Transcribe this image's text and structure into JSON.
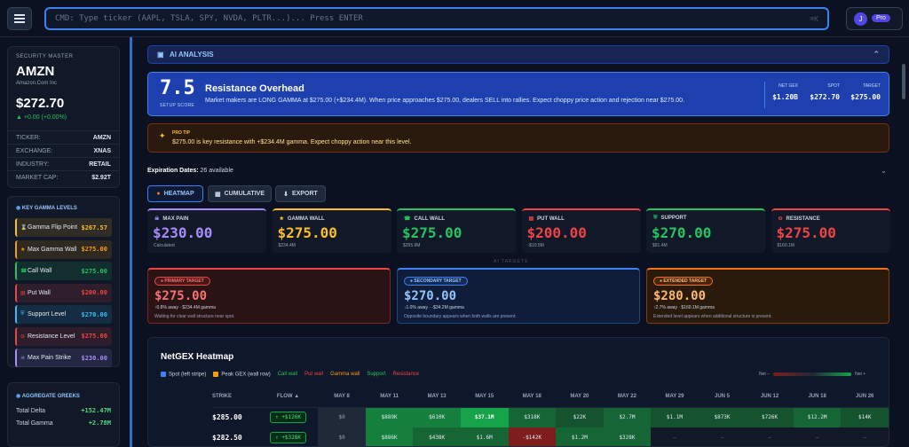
{
  "topbar": {
    "cmd_placeholder": "CMD: Type ticker (AAPL, TSLA, SPY, NVDA, PLTR...)... Press ENTER",
    "shortcut": "⌘K",
    "user_initial": "J",
    "plan_badge": "Pro"
  },
  "security": {
    "section_label": "SECURITY MASTER",
    "ticker": "AMZN",
    "name": "Amazon.Com Inc",
    "price": "$272.70",
    "change": "▲ +0.00 (+0.00%)",
    "fields": [
      {
        "k": "TICKER:",
        "v": "AMZN"
      },
      {
        "k": "EXCHANGE:",
        "v": "XNAS"
      },
      {
        "k": "INDUSTRY:",
        "v": "RETAIL"
      },
      {
        "k": "MARKET CAP:",
        "v": "$2.92T"
      }
    ]
  },
  "gamma_levels": {
    "title": "KEY GAMMA LEVELS",
    "items": [
      {
        "label": "Gamma Flip Point",
        "value": "$267.57",
        "color": "#fbbf24",
        "icon": "hourglass-icon",
        "glyph": "⌛"
      },
      {
        "label": "Max Gamma Wall",
        "value": "$275.00",
        "color": "#f59e0b",
        "icon": "star-icon",
        "glyph": "★"
      },
      {
        "label": "Call Wall",
        "value": "$275.00",
        "color": "#22c55e",
        "icon": "phone-icon",
        "glyph": "☎"
      },
      {
        "label": "Put Wall",
        "value": "$200.00",
        "color": "#ef4444",
        "icon": "chart-down-icon",
        "glyph": "▤"
      },
      {
        "label": "Support Level",
        "value": "$270.00",
        "color": "#38bdf8",
        "icon": "shield-icon",
        "glyph": "⛨"
      },
      {
        "label": "Resistance Level",
        "value": "$275.00",
        "color": "#ef4444",
        "icon": "no-entry-icon",
        "glyph": "⊖"
      },
      {
        "label": "Max Pain Strike",
        "value": "$230.00",
        "color": "#a78bfa",
        "icon": "skull-icon",
        "glyph": "☠"
      }
    ]
  },
  "greeks": {
    "title": "AGGREGATE GREEKS",
    "items": [
      {
        "k": "Total Delta",
        "v": "+152.47M"
      },
      {
        "k": "Total Gamma",
        "v": "+2.78M"
      }
    ]
  },
  "ai": {
    "header": "AI ANALYSIS",
    "score": "7.5",
    "score_label": "SETUP SCORE",
    "title": "Resistance Overhead",
    "desc": "Market makers are LONG GAMMA at $275.00 (+$234.4M). When price approaches $275.00, dealers SELL into rallies. Expect choppy price action and rejection near $275.00.",
    "stats": [
      {
        "label": "NET GEX",
        "value": "$1.20B"
      },
      {
        "label": "SPOT",
        "value": "$272.70"
      },
      {
        "label": "TARGET",
        "value": "$275.00"
      }
    ],
    "tip_label": "PRO TIP",
    "tip_text": "$275.00 is key resistance with +$234.4M gamma. Expect choppy action near this level."
  },
  "expiration": {
    "label": "Expiration Dates:",
    "value": "26 available"
  },
  "tabs": [
    {
      "label": "HEATMAP",
      "glyph": "●"
    },
    {
      "label": "CUMULATIVE",
      "glyph": "▦"
    },
    {
      "label": "EXPORT",
      "glyph": "⬇"
    }
  ],
  "level_cards": [
    {
      "label": "MAX PAIN",
      "value": "$230.00",
      "sub": "Calculated",
      "color": "#a78bfa",
      "icon": "skull-icon",
      "glyph": "☠"
    },
    {
      "label": "GAMMA WALL",
      "value": "$275.00",
      "sub": "$234.4M",
      "color": "#fbbf24",
      "icon": "star-icon",
      "glyph": "★"
    },
    {
      "label": "CALL WALL",
      "value": "$275.00",
      "sub": "$255.9M",
      "color": "#22c55e",
      "icon": "phone-icon",
      "glyph": "☎"
    },
    {
      "label": "PUT WALL",
      "value": "$200.00",
      "sub": "-$10.5M",
      "color": "#ef4444",
      "icon": "chart-down-icon",
      "glyph": "▤"
    },
    {
      "label": "SUPPORT",
      "value": "$270.00",
      "sub": "$91.4M",
      "color": "#22c55e",
      "icon": "shield-icon",
      "glyph": "⛨"
    },
    {
      "label": "RESISTANCE",
      "value": "$275.00",
      "sub": "$160.1M",
      "color": "#ef4444",
      "icon": "no-entry-icon",
      "glyph": "⊖"
    }
  ],
  "ai_targets_label": "AI TARGETS",
  "targets": [
    {
      "badge": "● PRIMARY TARGET",
      "value": "$275.00",
      "meta": "↑0.8% away · $234.4M gamma",
      "desc": "Waiting for clear wall structure near spot.",
      "color": "#f87171",
      "bg": "#2a1314",
      "border": "#ef4444"
    },
    {
      "badge": "● SECONDARY TARGET",
      "value": "$270.00",
      "meta": "↓1.0% away · -$34.2M gamma",
      "desc": "Opposite boundary appears when both walls are present.",
      "color": "#93c5fd",
      "bg": "#0f1d3a",
      "border": "#3b82f6"
    },
    {
      "badge": "● EXTENDED TARGET",
      "value": "$280.00",
      "meta": "↑2.7% away · $160.1M gamma",
      "desc": "Extended level appears when additional structure is present.",
      "color": "#fdba74",
      "bg": "#2a1a0c",
      "border": "#f97316"
    }
  ],
  "heatmap": {
    "title": "NetGEX Heatmap",
    "legend": [
      {
        "label": "Spot (left stripe)",
        "color": "#3b82f6",
        "square": true
      },
      {
        "label": "Peak GEX (wall row)",
        "color": "#f59e0b",
        "square": true
      },
      {
        "label": "Call wall",
        "color": "#22c55e",
        "square": false
      },
      {
        "label": "Put wall",
        "color": "#ef4444",
        "square": false
      },
      {
        "label": "Gamma wall",
        "color": "#f59e0b",
        "square": false
      },
      {
        "label": "Support",
        "color": "#22c55e",
        "square": false
      },
      {
        "label": "Resistance",
        "color": "#ef4444",
        "square": false
      }
    ],
    "scale_neg": "Net −",
    "scale_pos": "Net +",
    "columns": [
      "STRIKE",
      "FLOW ▲",
      "MAY 8",
      "MAY 11",
      "MAY 13",
      "MAY 15",
      "MAY 18",
      "MAY 20",
      "MAY 22",
      "MAY 29",
      "JUN 5",
      "JUN 12",
      "JUN 18",
      "JUN 26"
    ],
    "rows": [
      {
        "strike": "$285.00",
        "flow": "↑ +$126K",
        "cells": [
          {
            "v": "$0",
            "bg": "#1f2937"
          },
          {
            "v": "$889K",
            "bg": "#15803d"
          },
          {
            "v": "$610K",
            "bg": "#15803d"
          },
          {
            "v": "$37.1M",
            "bg": "#16a34a",
            "bold": true
          },
          {
            "v": "$318K",
            "bg": "#166534"
          },
          {
            "v": "$22K",
            "bg": "#14532d"
          },
          {
            "v": "$2.7M",
            "bg": "#166534"
          },
          {
            "v": "$1.1M",
            "bg": "#14532d"
          },
          {
            "v": "$873K",
            "bg": "#14532d"
          },
          {
            "v": "$726K",
            "bg": "#14532d"
          },
          {
            "v": "$12.2M",
            "bg": "#166534"
          },
          {
            "v": "$14K",
            "bg": "#14532d"
          }
        ]
      },
      {
        "strike": "$282.50",
        "flow": "↑ +$328K",
        "cells": [
          {
            "v": "$0",
            "bg": "#1f2937"
          },
          {
            "v": "$886K",
            "bg": "#15803d"
          },
          {
            "v": "$438K",
            "bg": "#166534"
          },
          {
            "v": "$1.6M",
            "bg": "#166534"
          },
          {
            "v": "-$142K",
            "bg": "#7f1d1d"
          },
          {
            "v": "$1.2M",
            "bg": "#166534"
          },
          {
            "v": "$328K",
            "bg": "#166534"
          },
          {
            "v": "—",
            "bg": "#111827"
          },
          {
            "v": "—",
            "bg": "#111827"
          },
          {
            "v": "—",
            "bg": "#111827"
          },
          {
            "v": "—",
            "bg": "#111827"
          },
          {
            "v": "—",
            "bg": "#111827"
          }
        ]
      }
    ]
  }
}
